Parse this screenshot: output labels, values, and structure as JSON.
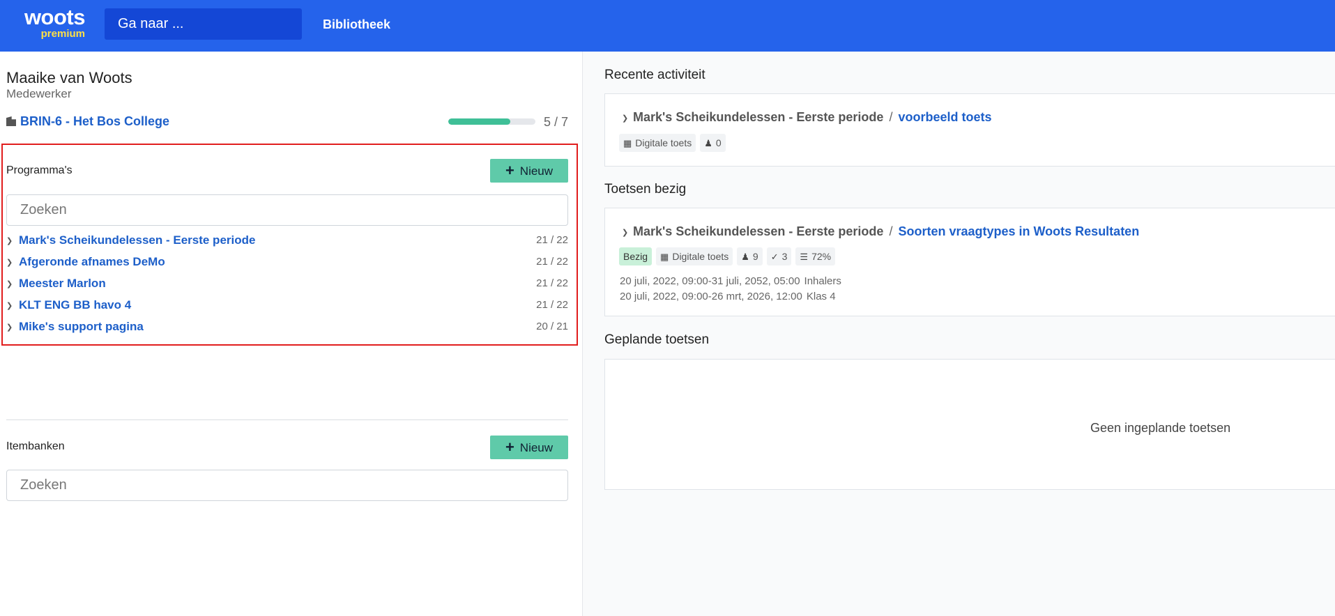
{
  "topbar": {
    "logo_main": "woots",
    "logo_sub": "premium",
    "goto_placeholder": "Ga naar ...",
    "nav_library": "Bibliotheek"
  },
  "user": {
    "name": "Maaike van Woots",
    "role": "Medewerker"
  },
  "organization": {
    "name": "BRIN-6 - Het Bos College",
    "progress_value": 5,
    "progress_max": 7,
    "progress_text": "5 / 7"
  },
  "programs": {
    "title": "Programma's",
    "new_label": "Nieuw",
    "search_placeholder": "Zoeken",
    "items": [
      {
        "label": "Mark's Scheikundelessen - Eerste periode",
        "count": "21 / 22"
      },
      {
        "label": "Afgeronde afnames DeMo",
        "count": "21 / 22"
      },
      {
        "label": "Meester Marlon",
        "count": "21 / 22"
      },
      {
        "label": "KLT ENG BB havo 4",
        "count": "21 / 22"
      },
      {
        "label": "Mike's support pagina",
        "count": "20 / 21"
      }
    ]
  },
  "itembanks": {
    "title": "Itembanken",
    "new_label": "Nieuw",
    "search_placeholder": "Zoeken"
  },
  "recent": {
    "title": "Recente activiteit",
    "course": "Mark's Scheikundelessen - Eerste periode",
    "separator": "/",
    "assignment": "voorbeeld toets",
    "type_chip": "Digitale toets",
    "participants": "0"
  },
  "in_progress": {
    "title": "Toetsen bezig",
    "course": "Mark's Scheikundelessen - Eerste periode",
    "separator": "/",
    "assignment": "Soorten vraagtypes in Woots Resultaten",
    "status_chip": "Bezig",
    "type_chip": "Digitale toets",
    "participants": "9",
    "submitted": "3",
    "graded": "72%",
    "schedules": [
      {
        "period": "20 juli, 2022, 09:00-31 juli, 2052, 05:00",
        "label": "Inhalers"
      },
      {
        "period": "20 juli, 2022, 09:00-26 mrt, 2026, 12:00",
        "label": "Klas 4"
      }
    ]
  },
  "planned": {
    "title": "Geplande toetsen",
    "empty_text": "Geen ingeplande toetsen"
  },
  "colors": {
    "topbar": "#2563eb",
    "link": "#1d5fc9",
    "button": "#5fcaa9",
    "progress": "#3fbf97",
    "highlight": "#e11d1d",
    "status_green": "#c9f0d9"
  },
  "icons": {
    "org": "building-icon",
    "item": "chevron-right-icon",
    "type": "grid-icon",
    "participants": "users-icon",
    "submitted": "shield-check-icon",
    "graded": "clipboard-search-icon"
  }
}
